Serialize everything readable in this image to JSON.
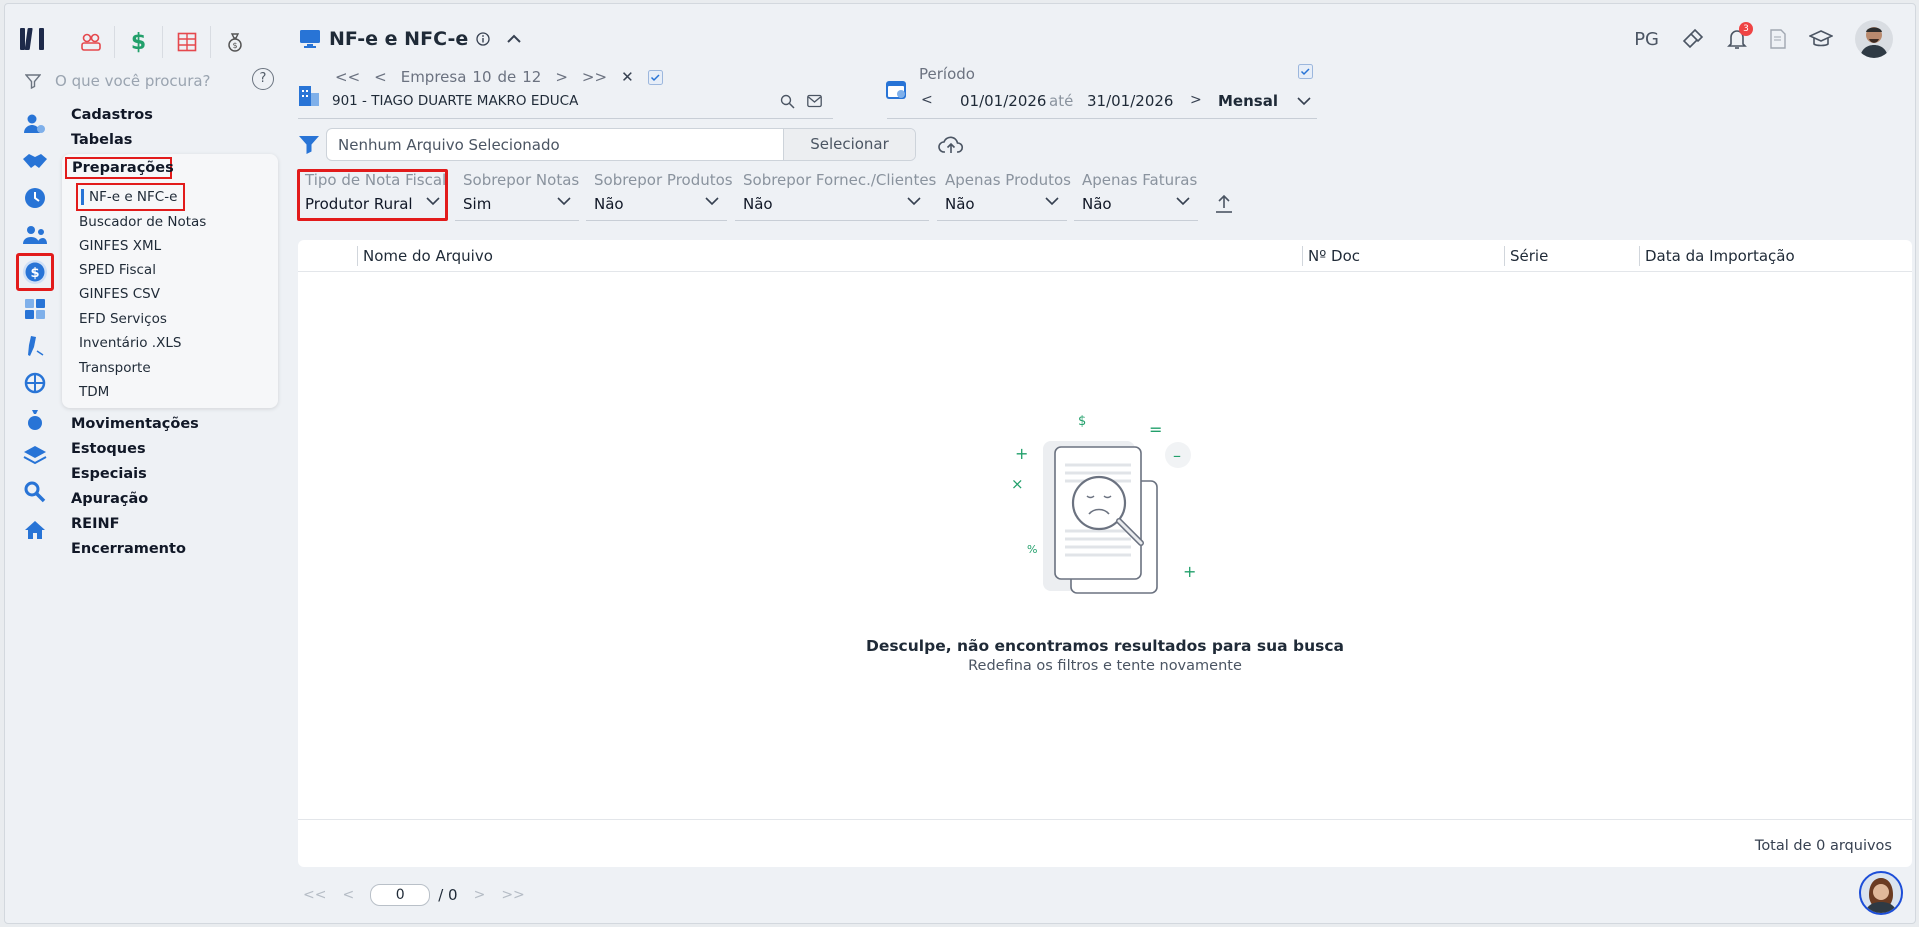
{
  "header": {
    "title": "NF-e e NFC-e",
    "user_initials": "PG",
    "notification_count": "3"
  },
  "search": {
    "placeholder": "O que você procura?"
  },
  "menu": {
    "top_items": [
      "Cadastros",
      "Tabelas"
    ],
    "active_group": "Preparações",
    "sub_selected": "NF-e e NFC-e",
    "sub_items": [
      "Buscador de Notas",
      "GINFES XML",
      "SPED Fiscal",
      "GINFES CSV",
      "EFD Serviços",
      "Inventário .XLS",
      "Transporte",
      "TDM"
    ],
    "bottom_items": [
      "Movimentações",
      "Estoques",
      "Especiais",
      "Apuração",
      "REINF",
      "Encerramento"
    ]
  },
  "empresa": {
    "label": "Empresa",
    "index": "10",
    "of_word": "de",
    "total": "12",
    "name": "901 - TIAGO DUARTE MAKRO EDUCA"
  },
  "periodo": {
    "label": "Período",
    "start": "01/01/2026",
    "between": "até",
    "end": "31/01/2026",
    "mode": "Mensal"
  },
  "file": {
    "placeholder": "Nenhum Arquivo Selecionado",
    "select_label": "Selecionar"
  },
  "filters": [
    {
      "label": "Tipo de Nota Fiscal",
      "value": "Produtor Rural"
    },
    {
      "label": "Sobrepor Notas",
      "value": "Sim"
    },
    {
      "label": "Sobrepor Produtos",
      "value": "Não"
    },
    {
      "label": "Sobrepor Fornec./Clientes",
      "value": "Não"
    },
    {
      "label": "Apenas Produtos",
      "value": "Não"
    },
    {
      "label": "Apenas Faturas",
      "value": "Não"
    }
  ],
  "table": {
    "columns": [
      "Nome do Arquivo",
      "Nº Doc",
      "Série",
      "Data da Importação"
    ],
    "empty_title": "Desculpe, não encontramos resultados para sua busca",
    "empty_subtitle": "Redefina os filtros e tente novamente",
    "total": "Total de 0 arquivos"
  },
  "pager": {
    "current": "0",
    "total": "/ 0"
  },
  "colors": {
    "accent": "#2874d6",
    "highlight": "#e21b1b",
    "money_green": "#22a06b"
  }
}
